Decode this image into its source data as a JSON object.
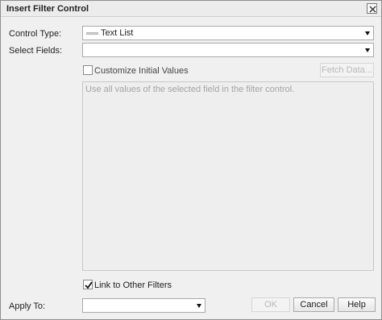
{
  "dialog": {
    "title": "Insert Filter Control"
  },
  "form": {
    "control_type_label": "Control Type:",
    "control_type_value": "Text List",
    "select_fields_label": "Select Fields:",
    "select_fields_value": "",
    "customize_label": "Customize Initial Values",
    "customize_checked": false,
    "fetch_data_label": "Fetch Data...",
    "values_hint": "Use all values of the selected field in the filter control.",
    "link_label": "Link to Other Filters",
    "link_checked": true,
    "apply_to_label": "Apply To:",
    "apply_to_value": ""
  },
  "buttons": {
    "ok": "OK",
    "cancel": "Cancel",
    "help": "Help"
  },
  "icons": {
    "close": "close-icon",
    "dropdown": "chevron-down-icon",
    "checkmark": "checkmark-icon",
    "text_list": "text-list-icon"
  }
}
